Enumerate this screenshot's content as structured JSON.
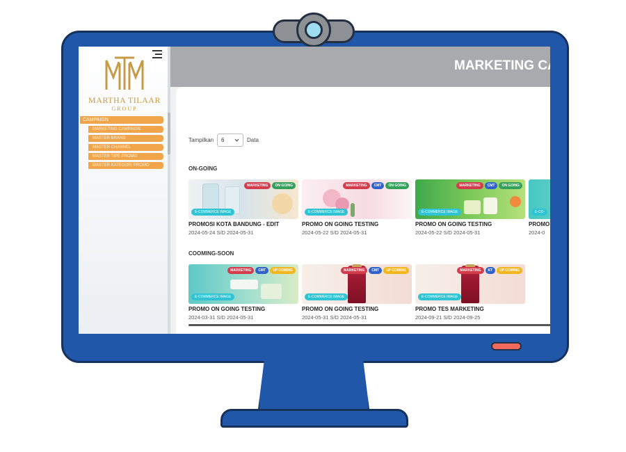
{
  "brand": {
    "name": "MARTHA TILAAR",
    "group": "GROUP"
  },
  "header": {
    "title": "MARKETING CA"
  },
  "sidebar": {
    "section": "CAMPAIGN",
    "items": [
      {
        "label": "MARKETING CAMPAIGN"
      },
      {
        "label": "MASTER BRAND"
      },
      {
        "label": "MASTER CHANNEL"
      },
      {
        "label": "MASTER TIPE PROMO"
      },
      {
        "label": "MASTER KATEGORI PROMO"
      }
    ]
  },
  "filter": {
    "show_label": "Tampilkan",
    "value": "6",
    "data_label": "Data"
  },
  "sections": [
    {
      "title": "ON-GOING",
      "cards": [
        {
          "title": "PROMOSI KOTA BANDUNG - EDIT",
          "date": "2024-05-24 S/D 2024-05-31",
          "badges": [
            "MARKETING",
            "ON GOING"
          ],
          "type": "E-COMMERCE IMAGE",
          "theme": "lab"
        },
        {
          "title": "PROMO ON GOING TESTING",
          "date": "2024-05-22 S/D 2024-05-31",
          "badges": [
            "MARKETING",
            "CMT",
            "ON GOING"
          ],
          "type": "E-COMMERCE IMAGE",
          "theme": "floral"
        },
        {
          "title": "PROMO ON GOING TESTING",
          "date": "2024-05-22 S/D 2024-05-31",
          "badges": [
            "MARKETING",
            "CMT",
            "ON GOING"
          ],
          "type": "E-COMMERCE IMAGE",
          "theme": "green"
        },
        {
          "title": "PROMO",
          "date": "2024-0",
          "badges": [],
          "type": "E-CO",
          "theme": "teal"
        }
      ]
    },
    {
      "title": "COOMING-SOON",
      "cards": [
        {
          "title": "PROMO ON GOING TESTING",
          "date": "2024-03-31 S/D 2024-05-31",
          "badges": [
            "MARKETING",
            "CMT",
            "UP COMING"
          ],
          "type": "E-COMMERCE IMAGE",
          "theme": "teal-green"
        },
        {
          "title": "PROMO ON GOING TESTING",
          "date": "2024-05-31 S/D 2024-05-31",
          "badges": [
            "MARKETING",
            "CMT",
            "UP COMING"
          ],
          "type": "E-COMMERCE IMAGE",
          "theme": "red-bottle"
        },
        {
          "title": "PROMO TES MARKETING",
          "date": "2024-09-21 S/D 2024-09-25",
          "badges": [
            "MARKETING",
            "KT",
            "UP COMING"
          ],
          "type": "E-COMMERCE IMAGE",
          "theme": "red-bottle"
        }
      ]
    }
  ],
  "colors": {
    "monitor": "#2057a9",
    "header": "#a9aaae",
    "nav_accent": "#f0a54a",
    "brand_gold": "#c79a45",
    "badge_marketing": "#d33c4c",
    "badge_cmt": "#3062c9",
    "badge_ongoing": "#34a05b",
    "badge_upcoming": "#f2b61f",
    "badge_type": "#2ec4d3"
  },
  "icons": [
    "webcam-icon",
    "hamburger-icon",
    "chevron-down-icon",
    "power-led-icon"
  ]
}
